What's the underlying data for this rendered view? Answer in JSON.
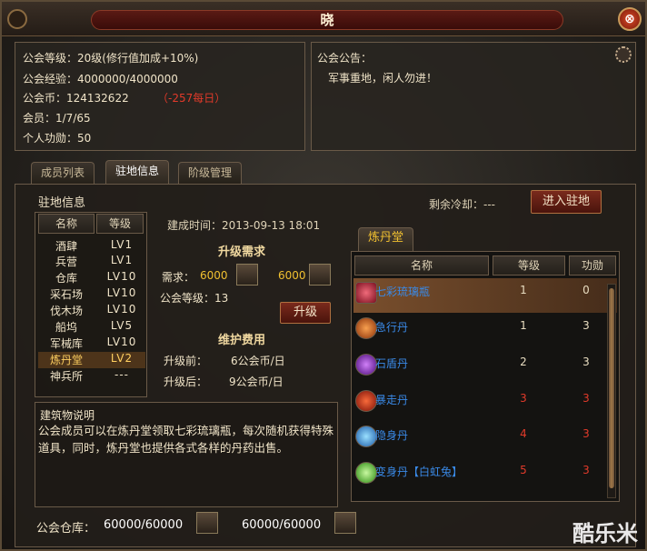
{
  "window": {
    "title": "晓",
    "close_label": "⊗"
  },
  "guild_info": {
    "level": "公会等级：20级(修行值加成+10%)",
    "exp": "公会经验：4000000/4000000",
    "coin_label": "公会币：124132622",
    "coin_daily": "（-257每日）",
    "members": "会员：1/7/65",
    "merit": "个人功勋：50"
  },
  "notice": {
    "label": "公会公告：",
    "text": "军事重地，闲人勿进！"
  },
  "tabs": [
    {
      "label": "成员列表"
    },
    {
      "label": "驻地信息"
    },
    {
      "label": "阶级管理"
    }
  ],
  "station": {
    "heading": "驻地信息",
    "cooldown": "剩余冷却：---",
    "enter_button": "进入驻地",
    "col_name": "名称",
    "col_level": "等级",
    "buildings": [
      {
        "name": "酒肆",
        "level": "LV1"
      },
      {
        "name": "兵营",
        "level": "LV1"
      },
      {
        "name": "仓库",
        "level": "LV10"
      },
      {
        "name": "采石场",
        "level": "LV10"
      },
      {
        "name": "伐木场",
        "level": "LV10"
      },
      {
        "name": "船坞",
        "level": "LV5"
      },
      {
        "name": "军械库",
        "level": "LV10"
      },
      {
        "name": "炼丹堂",
        "level": "LV2"
      },
      {
        "name": "神兵所",
        "level": "---"
      }
    ]
  },
  "detail": {
    "built_time": "建成时间：2013-09-13  18:01",
    "upgrade_title": "升级需求",
    "need_label": "需求：",
    "need_value1": "6000",
    "need_value2": "6000",
    "guild_level_req": "公会等级：13",
    "upgrade_button": "升级",
    "maintain_title": "维护费用",
    "before_label": "升级前：",
    "before_value": "6公会币/日",
    "after_label": "升级后：",
    "after_value": "9公会币/日"
  },
  "description": {
    "title": "建筑物说明",
    "text": "公会成员可以在炼丹堂领取七彩琉璃瓶，每次随机获得特殊道具，同时，炼丹堂也提供各式各样的丹药出售。"
  },
  "pill_hall": {
    "tab": "炼丹堂",
    "col_name": "名称",
    "col_level": "等级",
    "col_merit": "功勋",
    "rows": [
      {
        "name": "七彩琉璃瓶",
        "level": "1",
        "merit": "0",
        "icon": "bottle-icon",
        "color": "#d8304a"
      },
      {
        "name": "急行丹",
        "level": "1",
        "merit": "3",
        "icon": "orange-pill-icon",
        "color": "#e06a1a"
      },
      {
        "name": "石盾丹",
        "level": "2",
        "merit": "3",
        "icon": "purple-pill-icon",
        "color": "#9a3ad8"
      },
      {
        "name": "暴走丹",
        "level": "3",
        "merit": "3",
        "icon": "red-pill-icon",
        "color": "#e03a1a"
      },
      {
        "name": "隐身丹",
        "level": "4",
        "merit": "3",
        "icon": "blue-pill-icon",
        "color": "#3aa8e8"
      },
      {
        "name": "变身丹【白虹兔】",
        "level": "5",
        "merit": "3",
        "icon": "green-pill-icon",
        "color": "#6ad83a"
      }
    ]
  },
  "warehouse": {
    "label": "公会仓库：",
    "value1": "60000/60000",
    "value2": "60000/60000"
  },
  "watermark": "酷乐米"
}
